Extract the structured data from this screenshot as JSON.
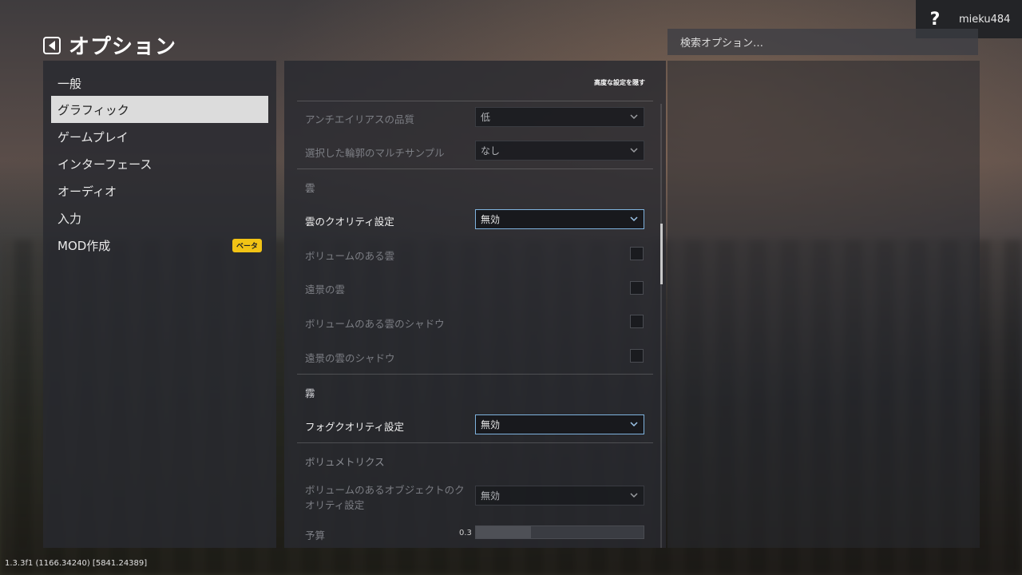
{
  "header": {
    "title": "オプション",
    "help_label": "?",
    "username": "mieku484",
    "search_placeholder": "検索オプション…"
  },
  "sidebar": {
    "items": [
      {
        "label": "一般"
      },
      {
        "label": "グラフィック",
        "active": true
      },
      {
        "label": "ゲームプレイ"
      },
      {
        "label": "インターフェース"
      },
      {
        "label": "オーディオ"
      },
      {
        "label": "入力"
      },
      {
        "label": "MOD作成",
        "badge": "ベータ"
      }
    ]
  },
  "main": {
    "hide_advanced": "高度な設定を隠す",
    "antialias_quality": {
      "label": "アンチエイリアスの品質",
      "value": "低"
    },
    "msaa": {
      "label": "選択した輪郭のマルチサンプル",
      "value": "なし"
    },
    "clouds_section": "雲",
    "cloud_quality": {
      "label": "雲のクオリティ設定",
      "value": "無効"
    },
    "volumetric_clouds": {
      "label": "ボリュームのある雲",
      "checked": false
    },
    "distant_clouds": {
      "label": "遠景の雲",
      "checked": false
    },
    "volumetric_cloud_shadows": {
      "label": "ボリュームのある雲のシャドウ",
      "checked": false
    },
    "distant_cloud_shadows": {
      "label": "遠景の雲のシャドウ",
      "checked": false
    },
    "fog_section": "霧",
    "fog_quality": {
      "label": "フォグクオリティ設定",
      "value": "無効"
    },
    "volumetrics_section": "ボリュメトリクス",
    "volumetric_objects_quality": {
      "label_line1": "ボリュームのあるオブジェクトのク",
      "label_line2": "オリティ設定",
      "value": "無効"
    },
    "budget": {
      "label": "予算",
      "value": "0.3",
      "fill_fraction": 0.33
    }
  },
  "footer": {
    "version": "1.3.3f1 (1166.34240) [5841.24389]"
  }
}
